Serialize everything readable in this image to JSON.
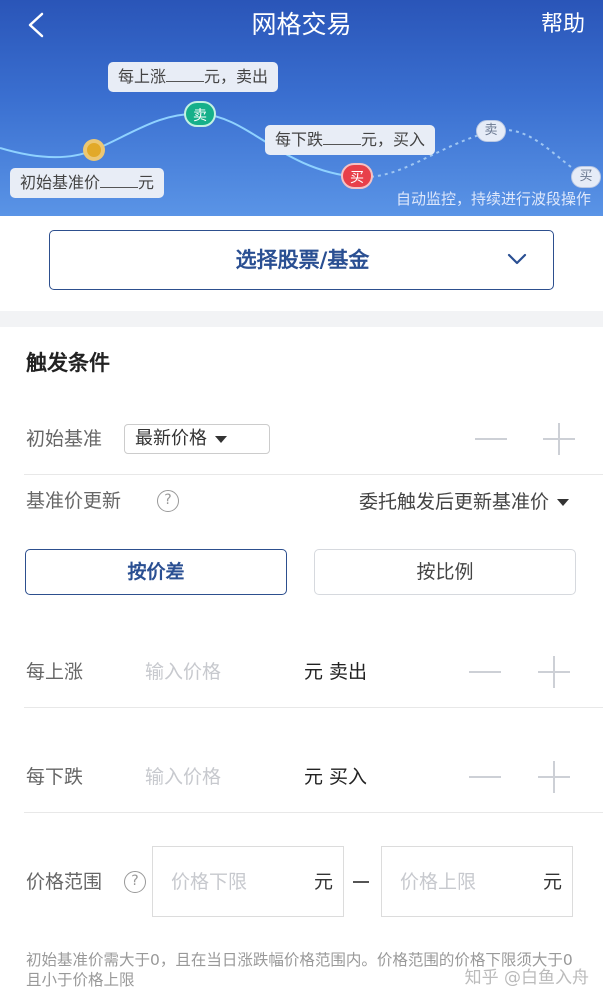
{
  "header": {
    "title": "网格交易",
    "help": "帮助",
    "bubble_up": {
      "prefix": "每上涨",
      "suffix": "元，卖出"
    },
    "bubble_down": {
      "prefix": "每下跌",
      "suffix": "元，买入"
    },
    "bubble_base": {
      "prefix": "初始基准价",
      "suffix": "元"
    },
    "sell_marker": "卖",
    "buy_marker": "买",
    "auto_tip": "自动监控，持续进行波段操作"
  },
  "select_stock": {
    "label": "选择股票/基金"
  },
  "trigger": {
    "title": "触发条件",
    "initial_base": {
      "label": "初始基准",
      "option": "最新价格"
    },
    "base_update": {
      "label": "基准价更新",
      "help": "?",
      "option": "委托触发后更新基准价"
    },
    "modes": {
      "by_diff": "按价差",
      "by_ratio": "按比例"
    },
    "rise": {
      "label": "每上涨",
      "placeholder": "输入价格",
      "unit_action": "元 卖出"
    },
    "fall": {
      "label": "每下跌",
      "placeholder": "输入价格",
      "unit_action": "元 买入"
    },
    "range": {
      "label": "价格范围",
      "help": "?",
      "lower_placeholder": "价格下限",
      "upper_placeholder": "价格上限",
      "unit": "元"
    },
    "note": "初始基准价需大于0，且在当日涨跌幅价格范围内。价格范围的价格下限须大于0且小于价格上限"
  },
  "watermark": "知乎 @白鱼入舟",
  "colors": {
    "accent": "#2d4f8e",
    "header_top": "#2a55b8",
    "sell": "#16b08a",
    "buy": "#e8404a"
  }
}
